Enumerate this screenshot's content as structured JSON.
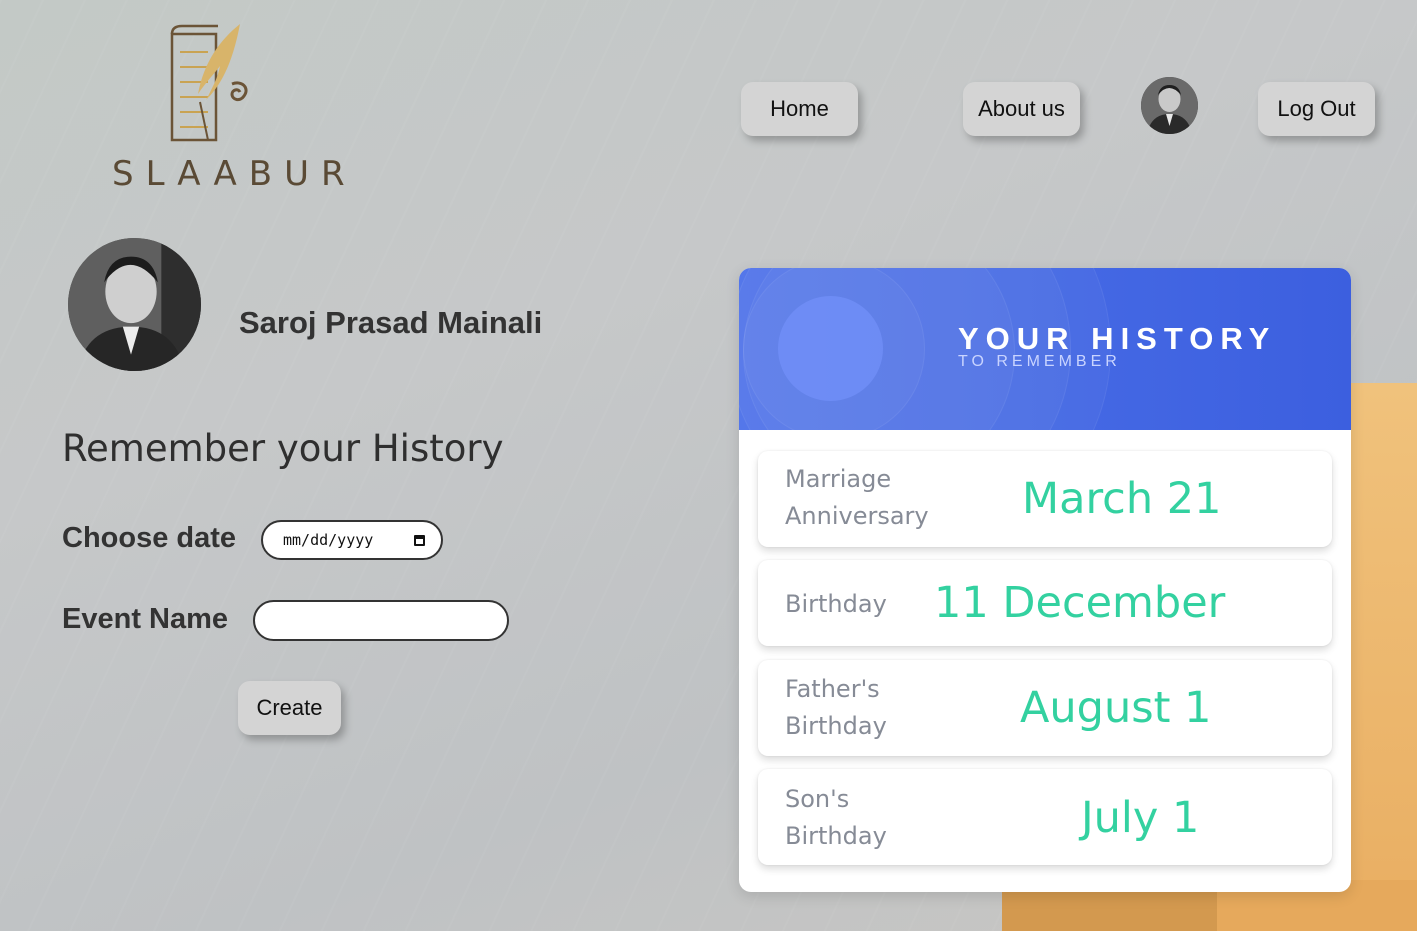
{
  "brand": {
    "name": "SLAABUR",
    "logo_icon": "scroll-quill-icon"
  },
  "nav": {
    "home_label": "Home",
    "about_label": "About us",
    "logout_label": "Log Out"
  },
  "profile": {
    "name": "Saroj Prasad Mainali"
  },
  "form": {
    "title": "Remember your History",
    "date_label": "Choose date",
    "date_placeholder": "mm/dd/yyyy",
    "event_label": "Event Name",
    "event_value": "",
    "create_label": "Create"
  },
  "history": {
    "title": "YOUR HISTORY",
    "subtitle": "TO REMEMBER",
    "events": [
      {
        "name": "Marriage Anniversary",
        "date": "March 21"
      },
      {
        "name": "Birthday",
        "date": "11 December"
      },
      {
        "name": "Father's Birthday",
        "date": "August 1"
      },
      {
        "name": "Son's Birthday",
        "date": "July 1"
      }
    ]
  },
  "colors": {
    "accent_blue": "#4e73ea",
    "date_green": "#33d1a0",
    "logo_gold": "#c9a352"
  }
}
